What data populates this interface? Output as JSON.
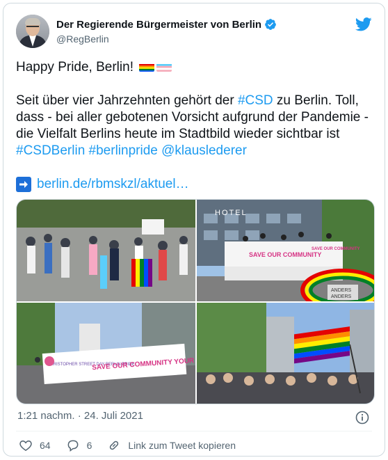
{
  "author": {
    "name": "Der Regierende Bürgermeister von Berlin",
    "handle": "@RegBerlin"
  },
  "tweet": {
    "greeting": "Happy Pride, Berlin!",
    "body_pre": "Seit über vier Jahrzehnten gehört der ",
    "hashtag_csd": "#CSD",
    "body_post": " zu Berlin. Toll, dass - bei aller gebotenen Vorsicht aufgrund der Pandemie - die Vielfalt Berlins heute im Stadtbild wieder sichtbar ist ",
    "hashtag_csdberlin": "#CSDBerlin",
    "hashtag_berlinpride": "#berlinpride",
    "mention": "@klauslederer",
    "link": "berlin.de/rbmskzl/aktuel…"
  },
  "media": {
    "photo2_sign": "HOTEL",
    "photo2_banner_left": "SAVE OUR COMMUNITY",
    "photo2_banner_right": "SAVE OUR COMMUNITY",
    "photo3_banner_logo": "CHRISTOPHER STREET DAY BERLIN PRIDE",
    "photo3_banner_main": "SAVE OUR COMMUNITY YOUR PRIDE",
    "photo2_balloon": "ANDERS",
    "photo2_balloon_2": "ANDERS"
  },
  "meta": {
    "timestamp": "1:21 nachm. · 24. Juli 2021"
  },
  "actions": {
    "likes": "64",
    "replies": "6",
    "copy_link": "Link zum Tweet kopieren"
  },
  "colors": {
    "text": "#0f1419",
    "secondary": "#536471",
    "link": "#1d9bf0",
    "verified": "#1d9bf0",
    "border": "#cfd9de"
  }
}
